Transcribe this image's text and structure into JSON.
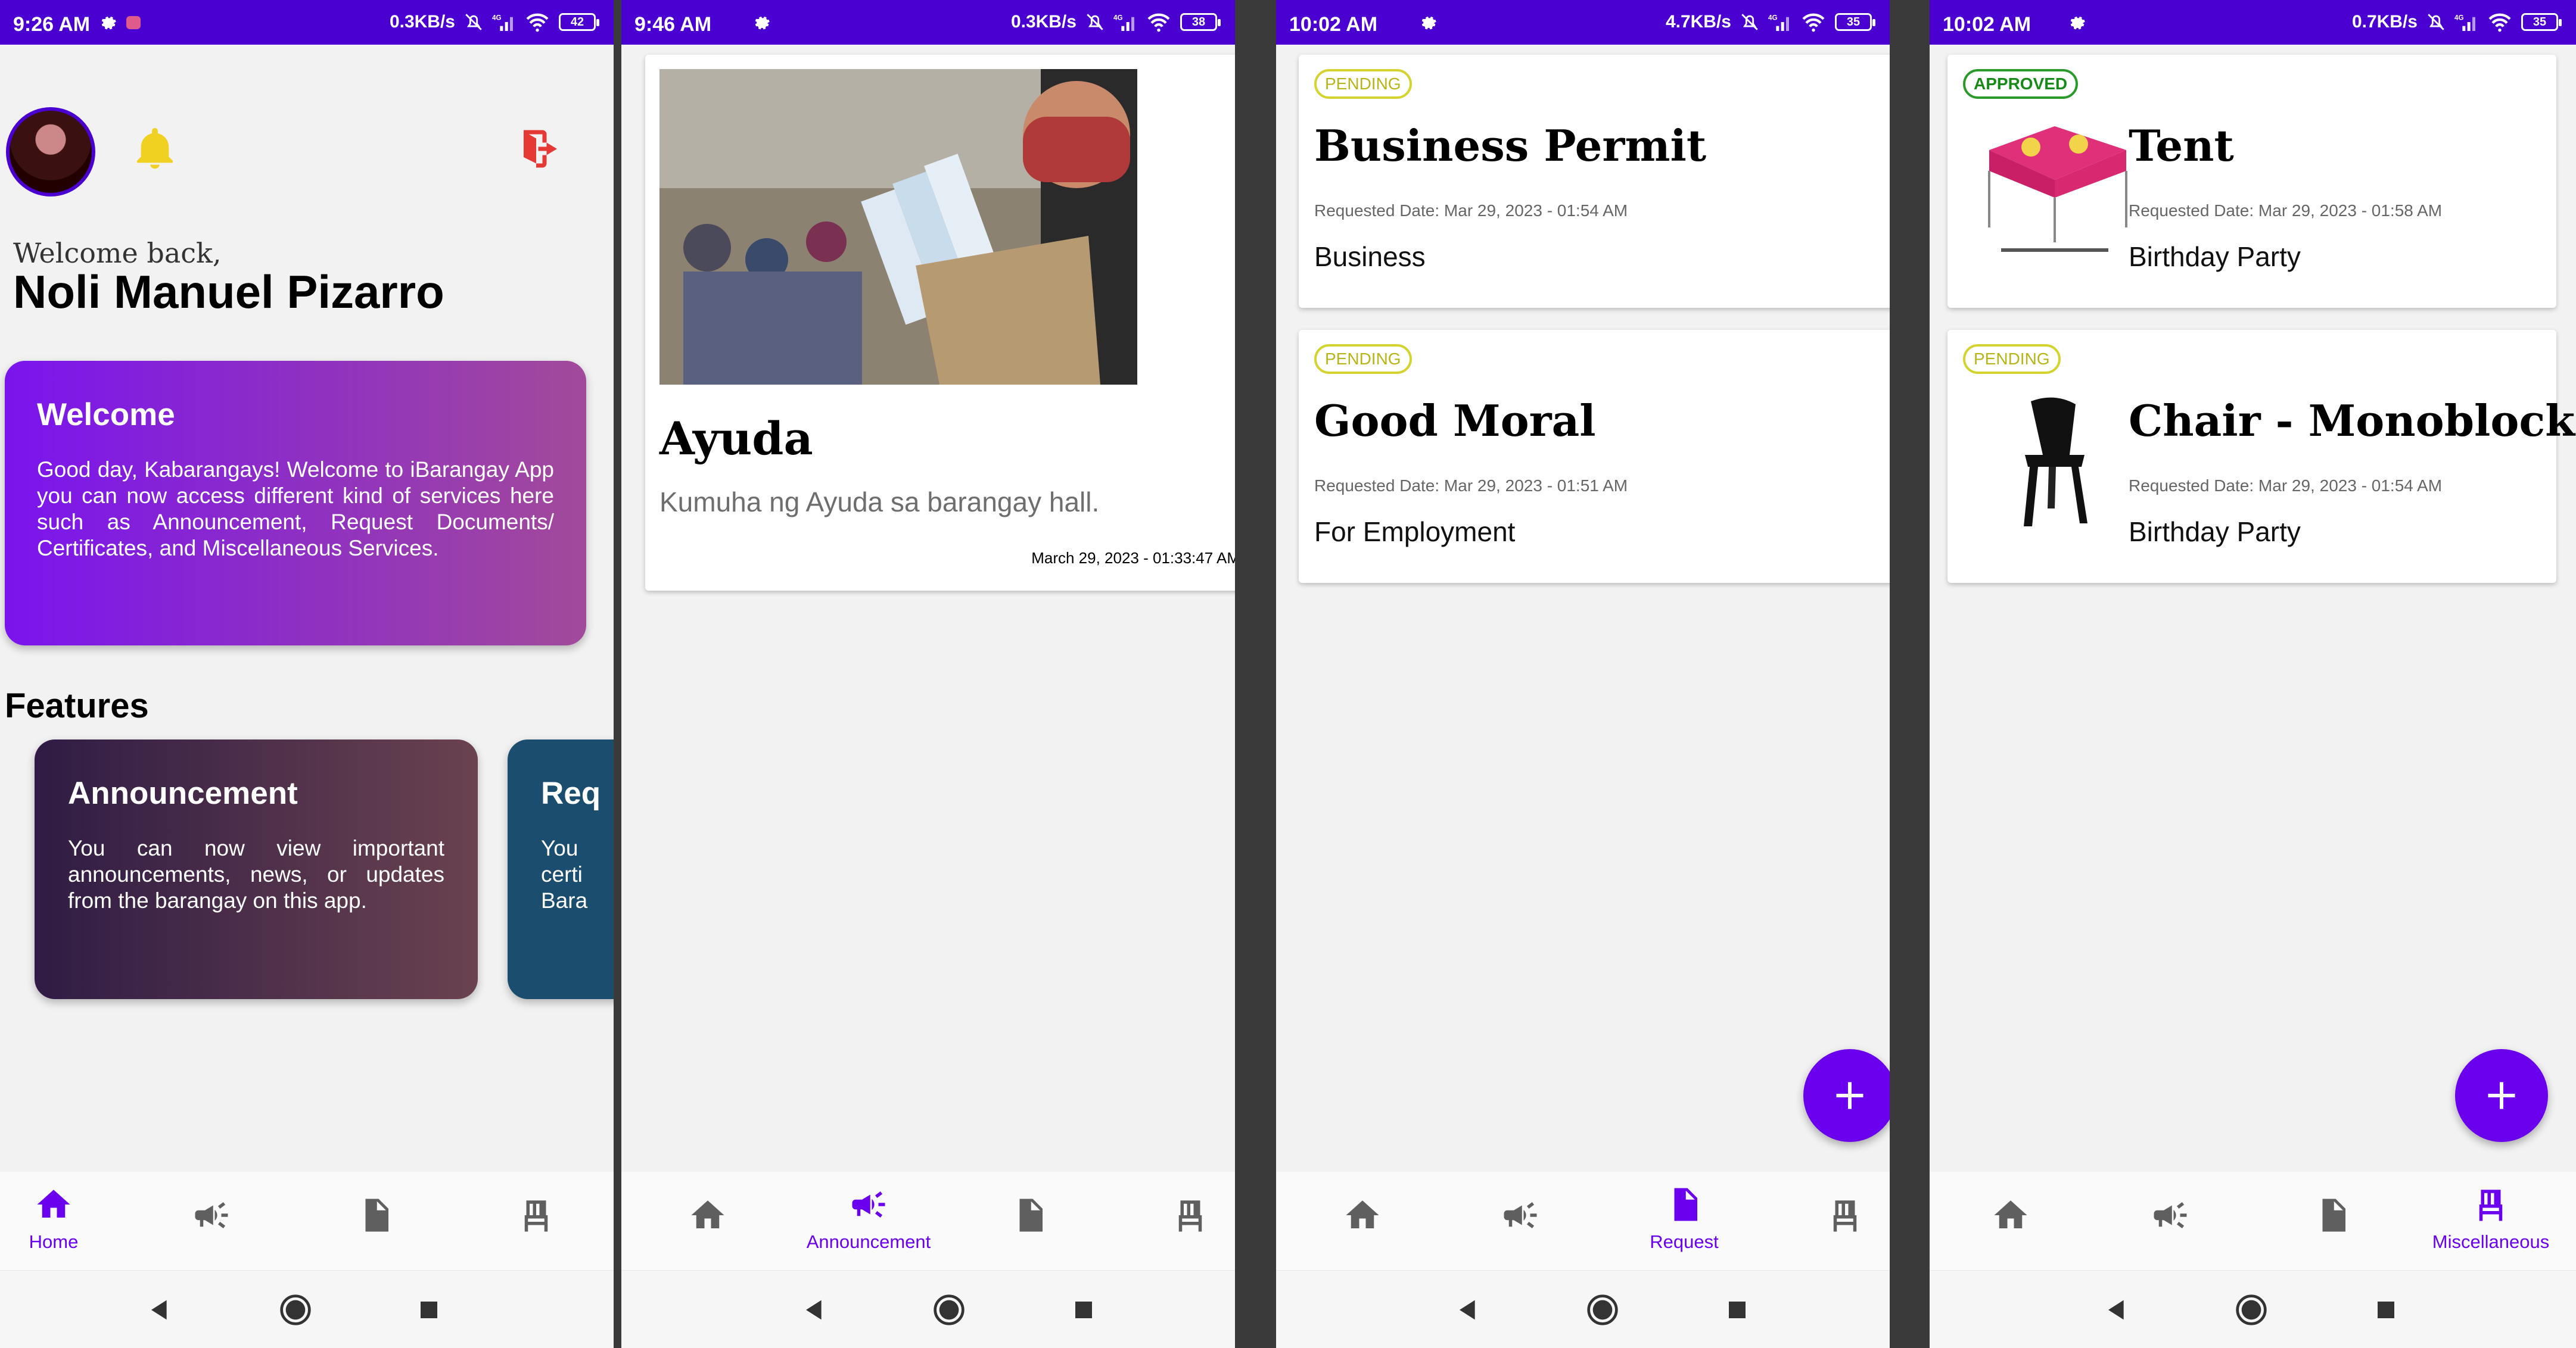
{
  "colors": {
    "primary": "#6a00ee",
    "status_bar": "#4a00d0",
    "pending": "#d4d431",
    "approved": "#2a9a2a",
    "logout": "#e53935",
    "bell": "#f0d020"
  },
  "panels": [
    {
      "status": {
        "time": "9:26 AM",
        "speed": "0.3KB/s",
        "battery": "42"
      },
      "welcome_small": "Welcome back,",
      "user_name": "Noli Manuel Pizarro",
      "welcome_card": {
        "title": "Welcome",
        "body": "Good day, Kabarangays! Welcome to iBarangay App you can now access different kind of services here such as Announcement, Request Documents/ Certificates, and Miscellaneous Services."
      },
      "features_title": "Features",
      "features": [
        {
          "title": "Announcement",
          "body": "You can now view important announcements, news, or updates from the barangay on this app."
        },
        {
          "title": "Req",
          "body": "You certi Bara"
        }
      ],
      "nav_active_label": "Home"
    },
    {
      "status": {
        "time": "9:46 AM",
        "speed": "0.3KB/s",
        "battery": "38"
      },
      "announcement": {
        "title": "Ayuda",
        "body": "Kumuha ng Ayuda sa barangay hall.",
        "date": "March 29, 2023 - 01:33:47 AM"
      },
      "nav_active_label": "Announcement"
    },
    {
      "status": {
        "time": "10:02 AM",
        "speed": "4.7KB/s",
        "battery": "35"
      },
      "requests": [
        {
          "status": "PENDING",
          "title": "Business Permit",
          "date": "Requested Date: Mar 29, 2023 - 01:54 AM",
          "purpose": "Business"
        },
        {
          "status": "PENDING",
          "title": "Good Moral",
          "date": "Requested Date: Mar 29, 2023 - 01:51 AM",
          "purpose": "For Employment"
        }
      ],
      "fab_icon": "plus-icon",
      "nav_active_label": "Request"
    },
    {
      "status": {
        "time": "10:02 AM",
        "speed": "0.7KB/s",
        "battery": "35"
      },
      "items": [
        {
          "status": "APPROVED",
          "title": "Tent",
          "date": "Requested Date: Mar 29, 2023 - 01:58 AM",
          "purpose": "Birthday Party"
        },
        {
          "status": "PENDING",
          "title": "Chair - Monoblock",
          "date": "Requested Date: Mar 29, 2023 - 01:54 AM",
          "purpose": "Birthday Party"
        }
      ],
      "fab_icon": "plus-icon",
      "nav_active_label": "Miscellaneous"
    }
  ],
  "nav_icons": [
    "home-icon",
    "megaphone-icon",
    "document-icon",
    "chair-icon"
  ]
}
